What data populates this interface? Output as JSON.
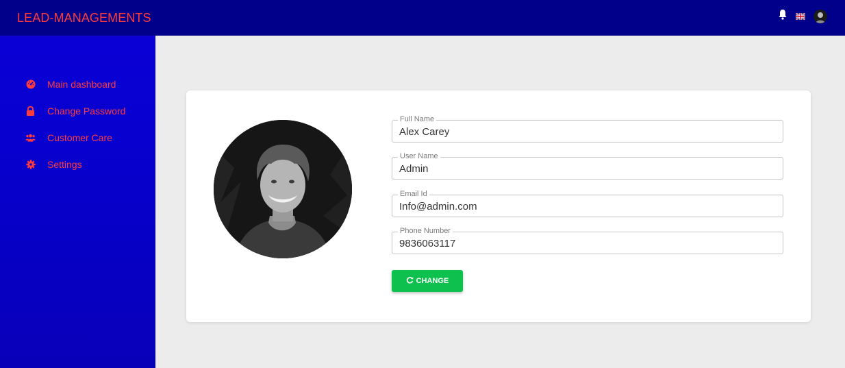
{
  "app": {
    "brand": "LEAD-MANAGEMENTS"
  },
  "topbar": {
    "icons": [
      "bell-icon",
      "uk-flag-icon",
      "user-avatar"
    ]
  },
  "colors": {
    "topbar": "#00008b",
    "sidebar": "#0a00d6",
    "accent_text": "#ff3b3b",
    "button": "#0ec04d"
  },
  "sidebar": {
    "items": [
      {
        "label": "Main dashboard",
        "icon": "dashboard-icon"
      },
      {
        "label": "Change Password",
        "icon": "lock-icon"
      },
      {
        "label": "Customer Care",
        "icon": "users-icon"
      },
      {
        "label": "Settings",
        "icon": "gear-icon"
      }
    ]
  },
  "profile": {
    "full_name": {
      "label": "Full Name",
      "value": "Alex Carey"
    },
    "user_name": {
      "label": "User Name",
      "value": "Admin"
    },
    "email": {
      "label": "Email Id",
      "value": "Info@admin.com"
    },
    "phone": {
      "label": "Phone Number",
      "value": "9836063117"
    },
    "button_label": "CHANGE"
  }
}
